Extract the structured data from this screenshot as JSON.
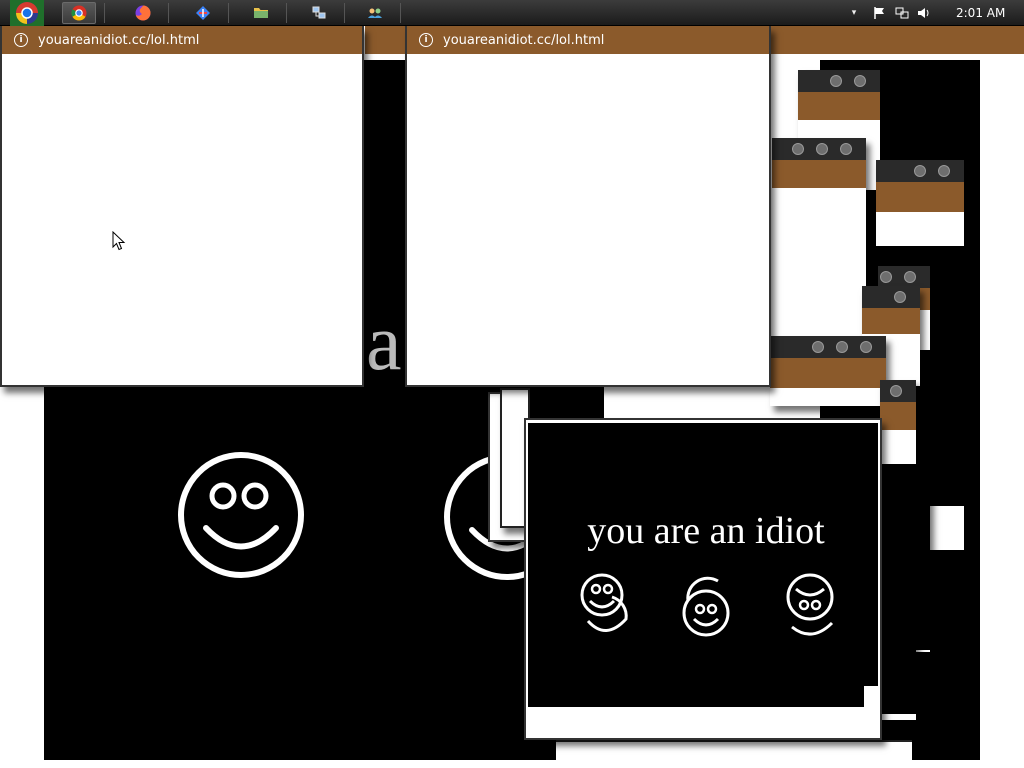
{
  "taskbar": {
    "buttons": [
      {
        "name": "chrome-taskbar-button",
        "icon": "chrome-icon"
      },
      {
        "name": "firefox-taskbar-button",
        "icon": "firefox-icon"
      },
      {
        "name": "app-taskbar-button",
        "icon": "app-icon"
      },
      {
        "name": "folder-taskbar-button",
        "icon": "folder-icon"
      },
      {
        "name": "network-taskbar-button",
        "icon": "network-icon"
      },
      {
        "name": "users-taskbar-button",
        "icon": "users-icon"
      }
    ],
    "clock": "2:01 AM"
  },
  "windows": {
    "url": "youareanidiot.cc/lol.html",
    "message": "you are an idiot",
    "partial_letter": "a"
  },
  "colors": {
    "title_brown": "#8b5a2b",
    "taskbar": "#2a2a2a",
    "background": "#000000"
  }
}
